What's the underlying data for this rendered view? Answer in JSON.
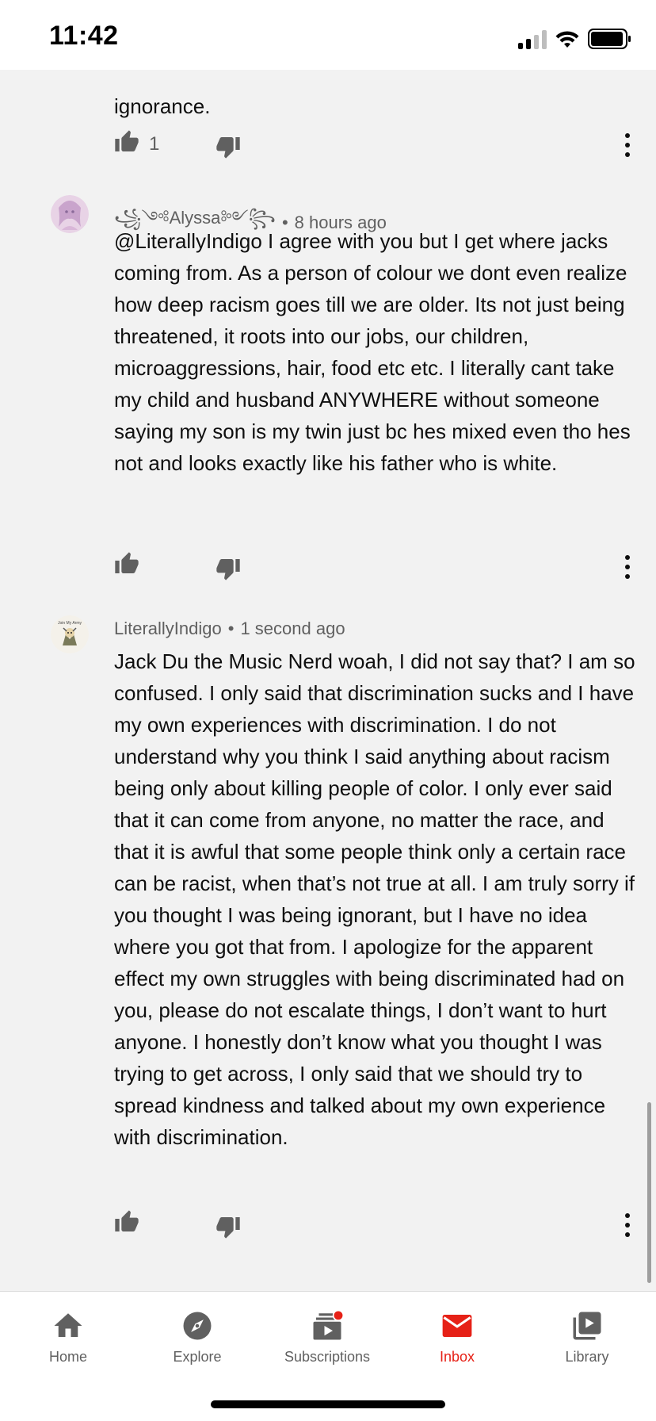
{
  "status_bar": {
    "time": "11:42"
  },
  "previous_comment": {
    "clipped_text": "ignorance.",
    "like_count": "1"
  },
  "comments": [
    {
      "author": "꧁༺Alyssa༻꧂",
      "separator": "•",
      "time": "8 hours ago",
      "text": "@LiterallyIndigo I agree with you but I get where jacks coming from. As a person of colour we dont even realize how deep racism goes till we are older. Its not just being threatened, it roots into our jobs, our children, microaggressions, hair, food etc etc. I literally cant take my child and husband ANYWHERE without someone saying my son is my twin just bc hes mixed even tho hes not and looks exactly like his father who is white."
    },
    {
      "author": "LiterallyIndigo",
      "separator": "•",
      "time": "1 second ago",
      "avatar_text": "Join My Army",
      "text": "Jack Du the Music Nerd woah, I did not say that? I am so confused. I only said that discrimination sucks and I have my own experiences with discrimination. I do not understand why you think I said anything about racism being only about killing people of color. I only ever said that it can come from anyone, no matter the race, and that it is awful that some people think only a certain race can be racist, when that’s not true at all. I am truly sorry if you thought I was being ignorant, but I have no idea where you got that from. I apologize for the apparent effect my own struggles with being discriminated had on you, please do not escalate things, I don’t want to hurt anyone. I honestly don’t know what you thought I was trying to get across, I only said that we should try to spread kindness and talked about my own experience with discrimination."
    }
  ],
  "nav": {
    "items": [
      {
        "label": "Home",
        "icon": "home-icon"
      },
      {
        "label": "Explore",
        "icon": "compass-icon"
      },
      {
        "label": "Subscriptions",
        "icon": "subscriptions-icon"
      },
      {
        "label": "Inbox",
        "icon": "mail-icon"
      },
      {
        "label": "Library",
        "icon": "library-icon"
      }
    ],
    "active": "Inbox"
  },
  "colors": {
    "accent": "#e62117",
    "background": "#f2f2f2",
    "secondary_text": "#606060",
    "icon": "#606060"
  }
}
